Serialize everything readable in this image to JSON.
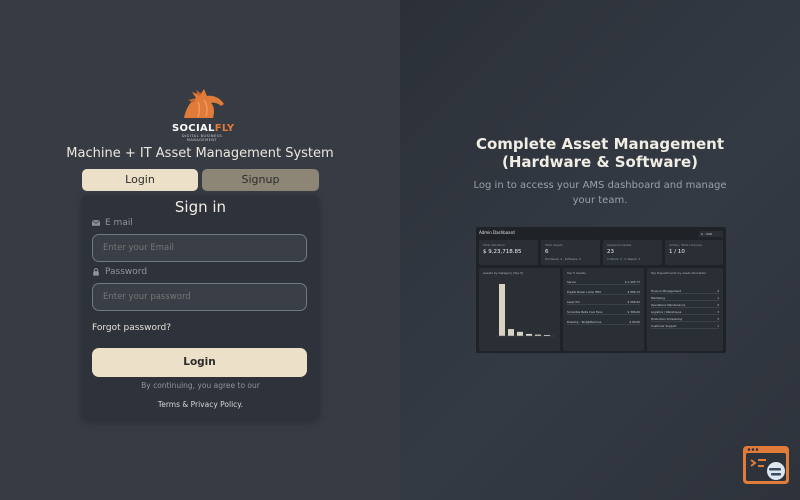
{
  "brand": {
    "name_part1": "SOCIAL",
    "name_part2": "FLY",
    "tagline": "DIGITAL BUSINESS MANAGEMENT"
  },
  "login_panel": {
    "system_title": "Machine + IT Asset Management System",
    "tabs": [
      {
        "label": "Login",
        "active": true
      },
      {
        "label": "Signup",
        "active": false
      }
    ],
    "heading": "Sign in",
    "email": {
      "label": "E mail",
      "placeholder": "Enter your Email",
      "icon": "envelope-icon"
    },
    "password": {
      "label": "Password",
      "placeholder": "Enter your password",
      "icon": "lock-icon"
    },
    "forgot_label": "Forgot password?",
    "login_button": "Login",
    "terms_line1": "By continuing, you agree to our",
    "terms_line2": "Terms & Privacy Policy."
  },
  "hero": {
    "title_line1": "Complete Asset Management",
    "title_line2": "(Hardware & Software)",
    "subtitle": "Log in to access your AMS dashboard and manage your team."
  },
  "dashboard_preview": {
    "title": "Admin Dashboard",
    "filter": "$ · USD",
    "stats": [
      {
        "key": "Total Valuation",
        "value": "$ 9,23,718.85",
        "sub": ""
      },
      {
        "key": "Total Assets",
        "value": "6",
        "sub": "Hardware: 4 · Software: 2"
      },
      {
        "key": "Assigned Assets",
        "value": "23",
        "sub": "In Stock: 4 · In Repair: 1"
      },
      {
        "key": "Active / Total Licenses",
        "value": "1 / 10",
        "sub": ""
      }
    ],
    "panel_titles": [
      "Assets by Category (Top 5)",
      "Top 5 Assets",
      "Top Departments by Asset Allocation"
    ],
    "top_assets": [
      {
        "name": "Server",
        "value": "$ 1,393.77"
      },
      {
        "name": "Digital Power Lamp HB4",
        "value": "$ 866.15"
      },
      {
        "name": "Laser Pro",
        "value": "$ 566.00"
      },
      {
        "name": "Scramble Belts Cool Fans",
        "value": "$ 396.00"
      },
      {
        "name": "Desktop - Test@Machine",
        "value": "$ 90.00"
      }
    ],
    "departments": [
      {
        "name": "Finance Management",
        "count": "2.8",
        "total": "4"
      },
      {
        "name": "Marketing",
        "count": "0.0",
        "total": "1"
      },
      {
        "name": "Operations Maintenance",
        "count": "0.0",
        "total": "2"
      },
      {
        "name": "Logistics / Warehouse",
        "count": "0.0",
        "total": "3"
      },
      {
        "name": "Production Scheduling",
        "count": "1.8",
        "total": "3"
      },
      {
        "name": "Customer Support",
        "count": "0.0",
        "total": "1"
      }
    ],
    "chart_bars": [
      7.5,
      1.0,
      0.6,
      0.3,
      0.2,
      0.15
    ]
  },
  "widget": {
    "icon": "chat-widget-icon"
  },
  "colors": {
    "accent": "#ece1c8",
    "secondary_tab": "#8d8677",
    "brand_orange": "#e07b39",
    "widget_orange": "#e07b39"
  }
}
